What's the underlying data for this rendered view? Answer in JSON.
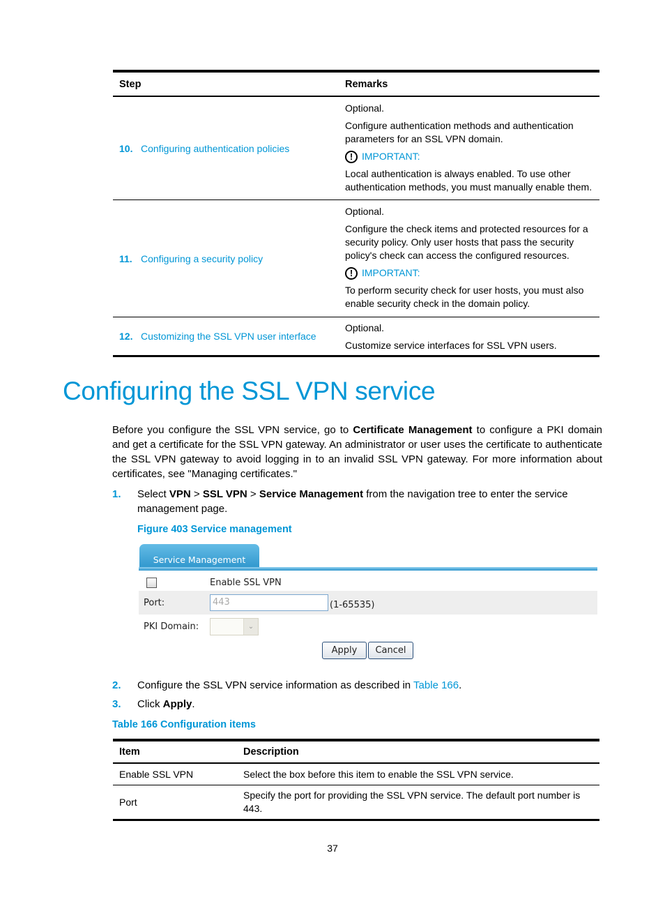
{
  "steps_table": {
    "headers": {
      "step": "Step",
      "remarks": "Remarks"
    },
    "rows": [
      {
        "num": "10.",
        "link": "Configuring authentication policies",
        "optional": "Optional.",
        "desc": "Configure authentication methods and authentication parameters for an SSL VPN domain.",
        "important_label": "IMPORTANT:",
        "important_text": "Local authentication is always enabled. To use other authentication methods, you must manually enable them."
      },
      {
        "num": "11.",
        "link": "Configuring a security policy",
        "optional": "Optional.",
        "desc": "Configure the check items and protected resources for a security policy. Only user hosts that pass the security policy's check can access the configured resources.",
        "important_label": "IMPORTANT:",
        "important_text": "To perform security check for user hosts, you must also enable security check in the domain policy."
      },
      {
        "num": "12.",
        "link": "Customizing the SSL VPN user interface",
        "optional": "Optional.",
        "desc": "Customize service interfaces for SSL VPN users."
      }
    ]
  },
  "heading": "Configuring the SSL VPN service",
  "intro": {
    "t1": "Before you configure the SSL VPN service, go to ",
    "b1": "Certificate Management",
    "t2": " to configure a PKI domain and get a certificate for the SSL VPN gateway. An administrator or user uses the certificate to authenticate the SSL VPN gateway to avoid logging in to an invalid SSL VPN gateway. For more information about certificates, see \"Managing certificates.\""
  },
  "step1": {
    "num": "1.",
    "t1": "Select ",
    "b1": "VPN",
    "sep1": " > ",
    "b2": "SSL VPN",
    "sep2": " > ",
    "b3": "Service Management",
    "t2": " from the navigation tree to enter the service management page."
  },
  "figure_caption": "Figure 403 Service management",
  "figure": {
    "tab": "Service Management",
    "enable_label": "Enable SSL VPN",
    "enable_checked": false,
    "port_label": "Port:",
    "port_value": "443",
    "port_range": "(1-65535)",
    "pki_label": "PKI Domain:",
    "pki_value": "",
    "apply": "Apply",
    "cancel": "Cancel"
  },
  "step2": {
    "num": "2.",
    "text": "Configure the SSL VPN service information as described in ",
    "link": "Table 166",
    "end": "."
  },
  "step3": {
    "num": "3.",
    "text": "Click ",
    "bold": "Apply",
    "end": "."
  },
  "table_caption": "Table 166 Configuration items",
  "config_table": {
    "headers": {
      "item": "Item",
      "description": "Description"
    },
    "rows": [
      {
        "item": "Enable SSL VPN",
        "description": "Select the box before this item to enable the SSL VPN service."
      },
      {
        "item": "Port",
        "description": "Specify the port for providing the SSL VPN service. The default port number is 443."
      }
    ]
  },
  "page_number": "37"
}
